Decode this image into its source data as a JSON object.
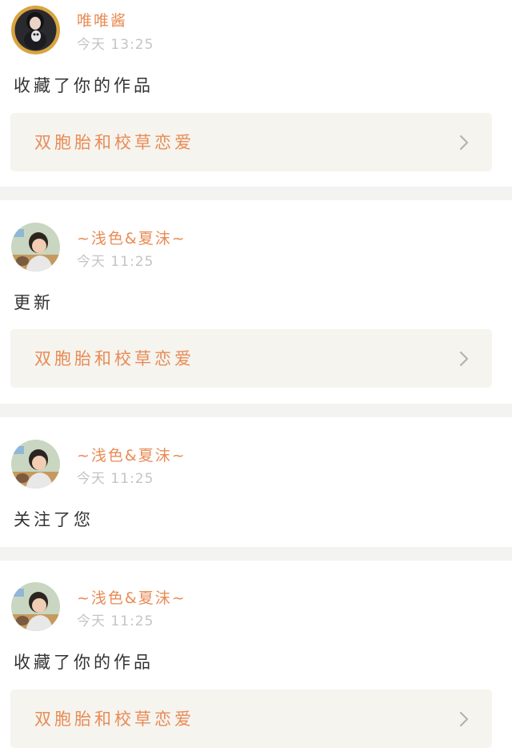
{
  "items": [
    {
      "user": "唯唯酱",
      "time": "今天 13:25",
      "action": "收藏了你的作品",
      "work": "双胞胎和校草恋爱",
      "avatar": "avatar-girl-with-plush"
    },
    {
      "user": "~浅色&夏沫~",
      "time": "今天 11:25",
      "action": "更新",
      "work": "双胞胎和校草恋爱",
      "avatar": "avatar-little-boy"
    },
    {
      "user": "~浅色&夏沫~",
      "time": "今天 11:25",
      "action": "关注了您",
      "avatar": "avatar-little-boy"
    },
    {
      "user": "~浅色&夏沫~",
      "time": "今天 11:25",
      "action": "收藏了你的作品",
      "work": "双胞胎和校草恋爱",
      "avatar": "avatar-little-boy"
    }
  ],
  "icons": {
    "chevron": "chevron-right-icon"
  },
  "colors": {
    "accent": "#e98b55",
    "time": "#c4c4c4",
    "card_bg": "#f5f4ef",
    "separator": "#f3f3f1",
    "text": "#333333"
  }
}
